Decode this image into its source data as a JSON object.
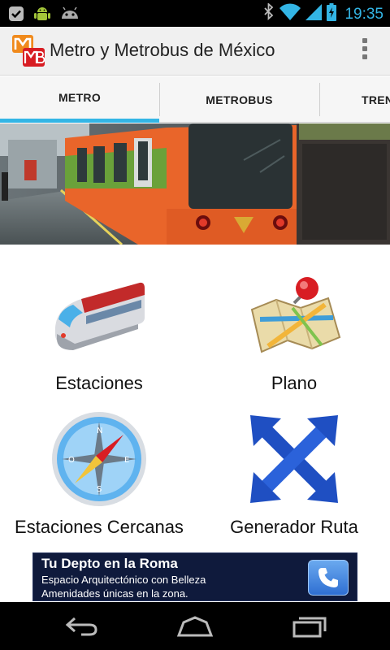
{
  "status_bar": {
    "time": "19:35",
    "notification_icons": [
      "check-icon",
      "android-icon",
      "android-debug-icon"
    ],
    "system_icons": [
      "bluetooth-icon",
      "wifi-icon",
      "signal-icon",
      "battery-charging-icon"
    ]
  },
  "action_bar": {
    "title": "Metro y Metrobus de México",
    "logo_icon": "metro-metrobus-logo-icon",
    "overflow_icon": "overflow-menu-icon"
  },
  "tabs": [
    {
      "label": "METRO",
      "selected": true
    },
    {
      "label": "METROBUS",
      "selected": false
    },
    {
      "label": "TREN",
      "selected": false
    }
  ],
  "accent_color": "#33b5e5",
  "grid": [
    {
      "label": "Estaciones",
      "icon": "train-icon"
    },
    {
      "label": "Plano",
      "icon": "map-pin-icon"
    },
    {
      "label": "Estaciones Cercanas",
      "icon": "compass-icon"
    },
    {
      "label": "Generador Ruta",
      "icon": "route-arrows-icon"
    }
  ],
  "ad": {
    "title": "Tu Depto en la Roma",
    "line1": "Espacio Arquitectónico con Belleza",
    "line2": "Amenidades únicas en la zona.",
    "call_icon": "phone-icon"
  },
  "nav_bar": {
    "buttons": [
      "back-icon",
      "home-icon",
      "recent-apps-icon"
    ]
  }
}
